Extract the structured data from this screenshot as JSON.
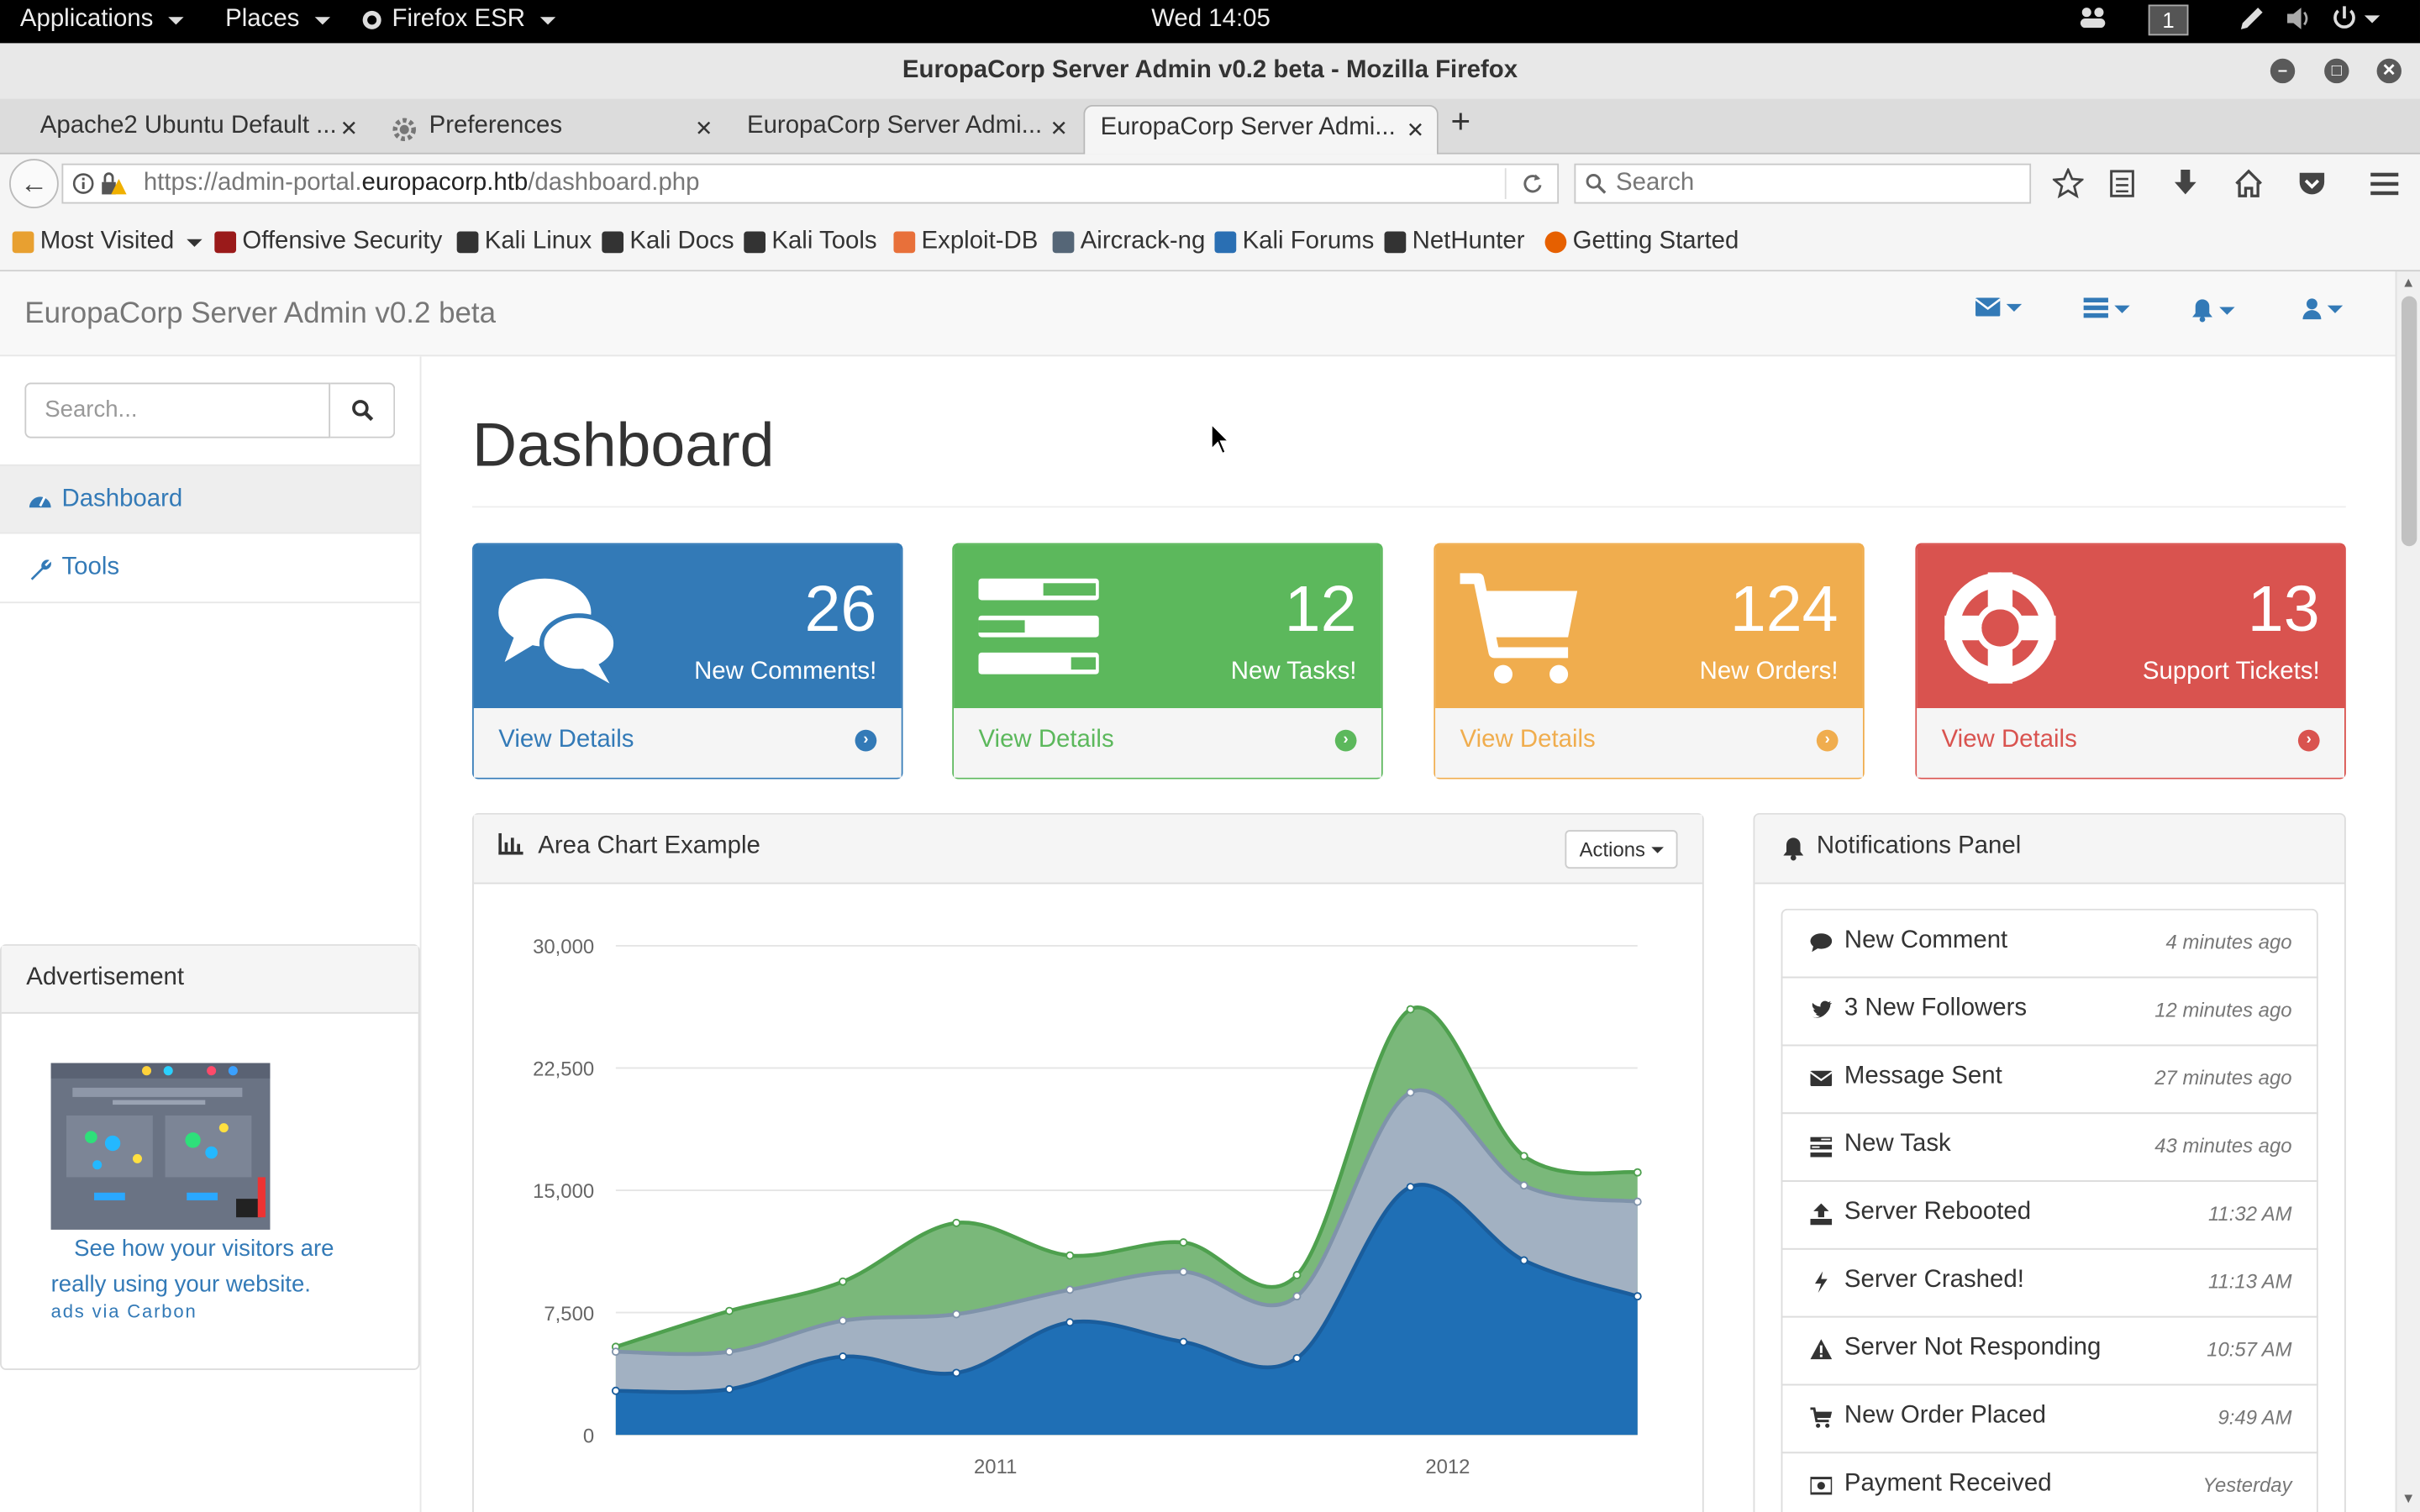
{
  "gnome": {
    "applications": "Applications",
    "places": "Places",
    "firefox": "Firefox ESR",
    "clock": "Wed 14:05",
    "workspace": "1"
  },
  "window": {
    "title": "EuropaCorp Server Admin v0.2 beta - Mozilla Firefox"
  },
  "tabs": [
    {
      "label": "Apache2 Ubuntu Default ..."
    },
    {
      "label": "Preferences"
    },
    {
      "label": "EuropaCorp Server Admi..."
    },
    {
      "label": "EuropaCorp Server Admi..."
    }
  ],
  "navbar": {
    "url_prefix": "https://admin-portal.",
    "url_domain": "europacorp.htb",
    "url_path": "/dashboard.php",
    "search_placeholder": "Search"
  },
  "bookmarks": [
    {
      "label": "Most Visited",
      "color": "#e8a030"
    },
    {
      "label": "Offensive Security",
      "color": "#9a1a1a"
    },
    {
      "label": "Kali Linux",
      "color": "#333333"
    },
    {
      "label": "Kali Docs",
      "color": "#333333"
    },
    {
      "label": "Kali Tools",
      "color": "#333333"
    },
    {
      "label": "Exploit-DB",
      "color": "#e8703a"
    },
    {
      "label": "Aircrack-ng",
      "color": "#556677"
    },
    {
      "label": "Kali Forums",
      "color": "#2a6fb3"
    },
    {
      "label": "NetHunter",
      "color": "#333333"
    },
    {
      "label": "Getting Started",
      "color": "#e66000"
    }
  ],
  "site": {
    "brand": "EuropaCorp Server Admin v0.2 beta",
    "sidebar": {
      "search_placeholder": "Search...",
      "items": [
        {
          "label": "Dashboard"
        },
        {
          "label": "Tools"
        }
      ],
      "ad": {
        "heading": "Advertisement",
        "text": "See how your visitors are really using your website.",
        "via": "ads via Carbon"
      }
    },
    "page_title": "Dashboard",
    "cards": [
      {
        "count": "26",
        "label": "New Comments!",
        "link": "View Details",
        "color": "#337ab7",
        "icon": "comments-icon"
      },
      {
        "count": "12",
        "label": "New Tasks!",
        "link": "View Details",
        "color": "#5cb85c",
        "icon": "tasks-icon"
      },
      {
        "count": "124",
        "label": "New Orders!",
        "link": "View Details",
        "color": "#f0ad4e",
        "icon": "shopping-cart-icon"
      },
      {
        "count": "13",
        "label": "Support Tickets!",
        "link": "View Details",
        "color": "#d9534f",
        "icon": "life-ring-icon"
      }
    ],
    "chart_panel": {
      "title": "Area Chart Example",
      "actions": "Actions"
    },
    "notifications": {
      "title": "Notifications Panel",
      "items": [
        {
          "label": "New Comment",
          "time": "4 minutes ago",
          "icon": "comment-icon"
        },
        {
          "label": "3 New Followers",
          "time": "12 minutes ago",
          "icon": "twitter-icon"
        },
        {
          "label": "Message Sent",
          "time": "27 minutes ago",
          "icon": "envelope-icon"
        },
        {
          "label": "New Task",
          "time": "43 minutes ago",
          "icon": "tasks-icon"
        },
        {
          "label": "Server Rebooted",
          "time": "11:32 AM",
          "icon": "upload-icon"
        },
        {
          "label": "Server Crashed!",
          "time": "11:13 AM",
          "icon": "bolt-icon"
        },
        {
          "label": "Server Not Responding",
          "time": "10:57 AM",
          "icon": "warning-icon"
        },
        {
          "label": "New Order Placed",
          "time": "9:49 AM",
          "icon": "shopping-cart-icon"
        },
        {
          "label": "Payment Received",
          "time": "Yesterday",
          "icon": "money-icon"
        }
      ]
    }
  },
  "chart_data": {
    "type": "area",
    "stacked": true,
    "ylim": [
      0,
      30000
    ],
    "yticks": [
      "30,000",
      "22,500",
      "15,000",
      "7,500",
      "0"
    ],
    "xtick_labels": [
      "2011",
      "2012"
    ],
    "series": [
      {
        "values": [
          2700,
          2800,
          4800,
          3800,
          6900,
          5700,
          4700,
          15200,
          10700,
          8500
        ],
        "color": "#1f6fb5"
      },
      {
        "values": [
          2400,
          2300,
          2200,
          3600,
          2000,
          4300,
          3800,
          5800,
          4600,
          5800
        ],
        "color": "#a2b1c2"
      },
      {
        "values": [
          300,
          2500,
          2400,
          5600,
          2100,
          1800,
          1300,
          5100,
          1800,
          1800
        ],
        "color": "#7ab87a"
      }
    ],
    "grid": true
  }
}
